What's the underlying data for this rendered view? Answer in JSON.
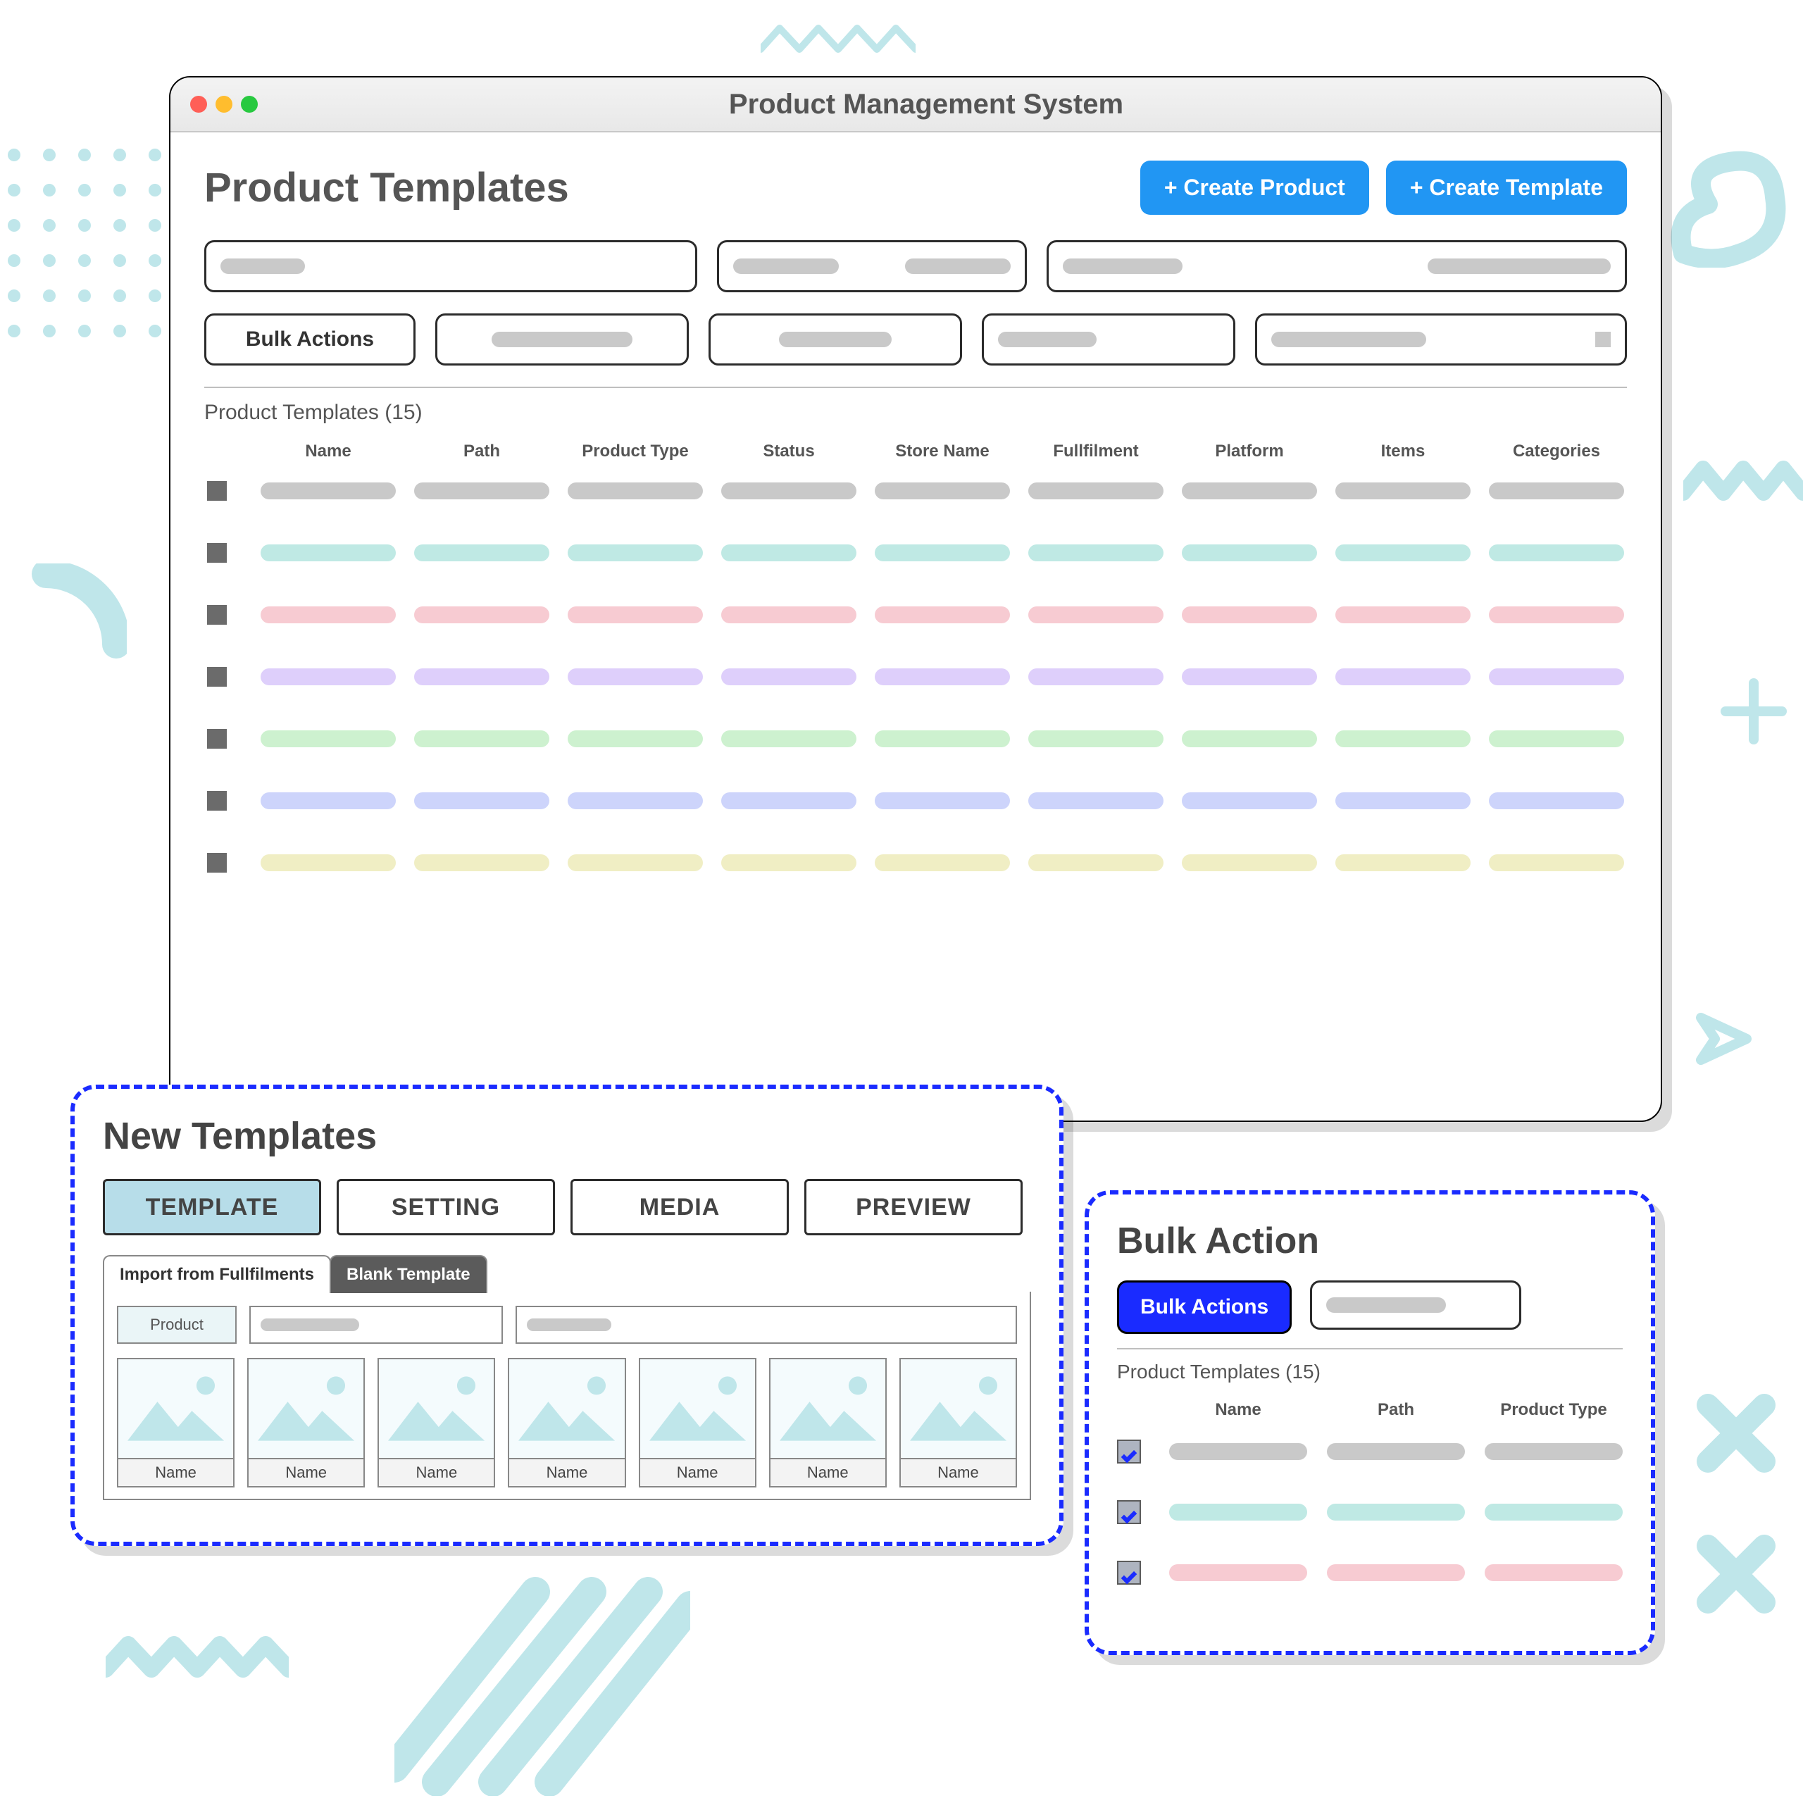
{
  "window": {
    "title": "Product Management System"
  },
  "main": {
    "heading": "Product Templates",
    "create_product_label": "+ Create Product",
    "create_template_label": "+ Create Template",
    "bulk_actions_label": "Bulk Actions",
    "section_label": "Product Templates (15)",
    "columns": [
      "Name",
      "Path",
      "Product Type",
      "Status",
      "Store Name",
      "Fullfilment",
      "Platform",
      "Items",
      "Categories"
    ],
    "row_colors": [
      "c-grey",
      "c-teal",
      "c-pink",
      "c-purple",
      "c-green",
      "c-blue",
      "c-yellow"
    ]
  },
  "new_templates": {
    "heading": "New Templates",
    "tabs": [
      "TEMPLATE",
      "SETTING",
      "MEDIA",
      "PREVIEW"
    ],
    "subtabs": {
      "import": "Import from Fullfilments",
      "blank": "Blank Template"
    },
    "product_label": "Product",
    "thumb_caption": "Name",
    "thumb_count": 7
  },
  "bulk_action": {
    "heading": "Bulk Action",
    "button_label": "Bulk Actions",
    "section_label": "Product Templates (15)",
    "columns": [
      "Name",
      "Path",
      "Product Type"
    ],
    "row_colors": [
      "c-grey",
      "c-teal",
      "c-pink"
    ]
  }
}
